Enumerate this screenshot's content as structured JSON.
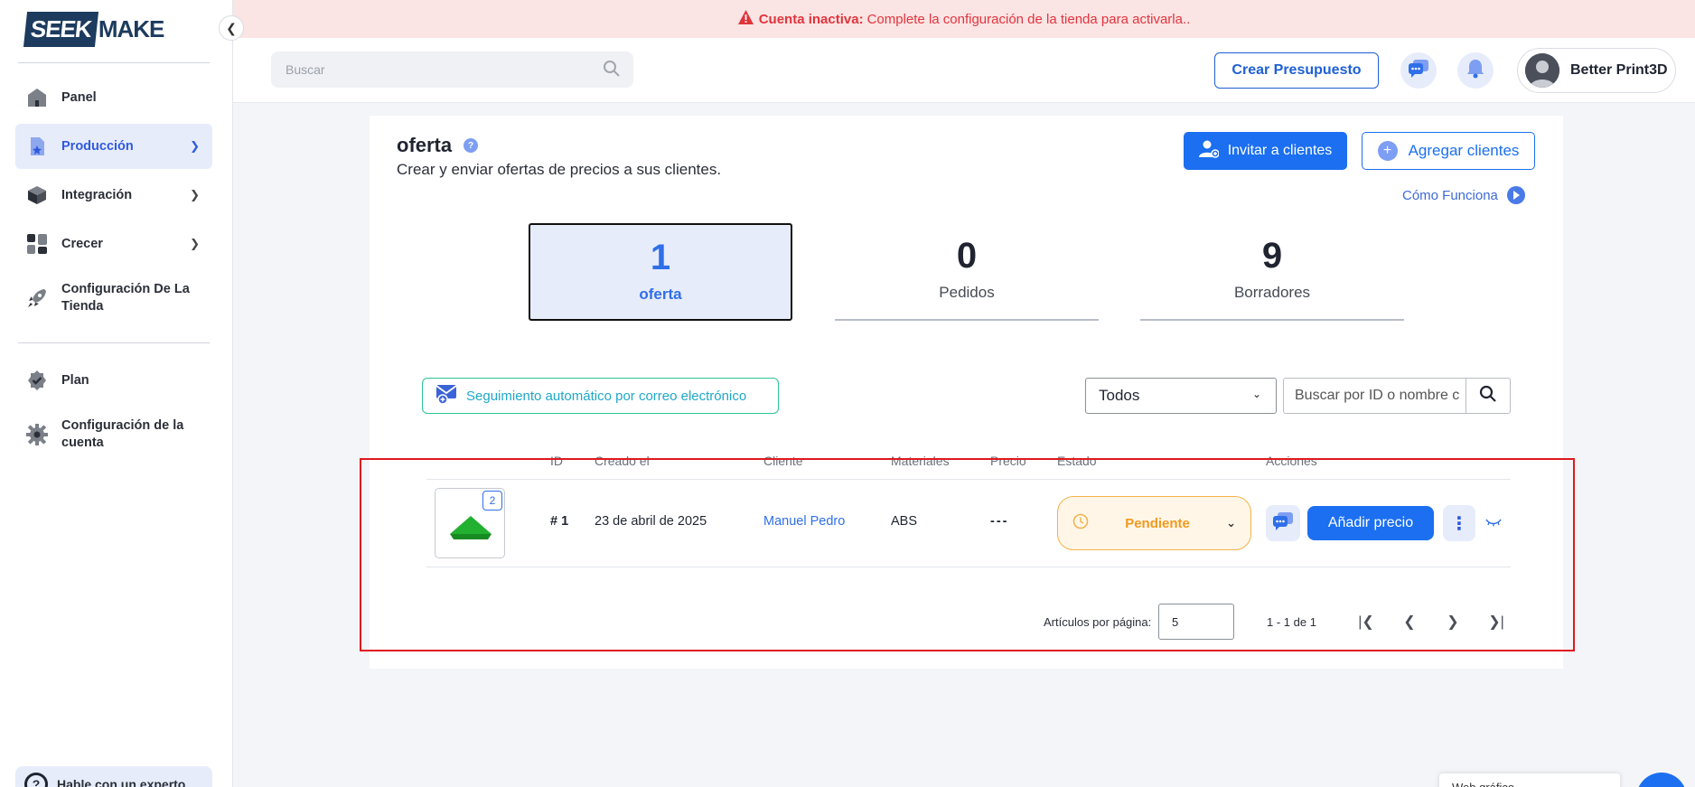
{
  "brand": {
    "logo_left": "SEEK",
    "logo_right": "MAKE"
  },
  "banner": {
    "title": "Cuenta inactiva:",
    "message": "Complete la configuración de la tienda para activarla.."
  },
  "sidebar": {
    "items": [
      {
        "label": "Panel",
        "icon": "home-icon"
      },
      {
        "label": "Producción",
        "icon": "document-star-icon",
        "active": true,
        "expandable": true
      },
      {
        "label": "Integración",
        "icon": "cube-icon",
        "expandable": true
      },
      {
        "label": "Crecer",
        "icon": "grid-icon",
        "expandable": true
      },
      {
        "label": "Configuración De La Tienda",
        "icon": "rocket-icon"
      },
      {
        "label": "Plan",
        "icon": "badge-check-icon"
      },
      {
        "label": "Configuración de la cuenta",
        "icon": "gear-icon"
      }
    ],
    "help": "Hable con un experto"
  },
  "header": {
    "search_placeholder": "Buscar",
    "create_quote": "Crear Presupuesto",
    "user_name": "Better Print3D"
  },
  "page": {
    "title": "oferta",
    "subtitle": "Crear y enviar ofertas de precios a sus clientes.",
    "invite_btn": "Invitar a clientes",
    "add_btn": "Agregar clientes",
    "how_link": "Cómo Funciona"
  },
  "stats": [
    {
      "value": "1",
      "label": "oferta",
      "selected": true
    },
    {
      "value": "0",
      "label": "Pedidos"
    },
    {
      "value": "9",
      "label": "Borradores"
    }
  ],
  "toolbar": {
    "follow_up": "Seguimiento automático por correo electrónico",
    "filter_value": "Todos",
    "search_placeholder": "Buscar por ID o nombre c"
  },
  "table": {
    "columns": [
      "ID",
      "Creado el",
      "Cliente",
      "Materiales",
      "Precio",
      "Estado",
      "Acciones"
    ],
    "rows": [
      {
        "thumb_badge": "2",
        "id": "# 1",
        "created": "23 de abril de 2025",
        "client": "Manuel Pedro",
        "material": "ABS",
        "price": "---",
        "status": "Pendiente",
        "action": "Añadir precio"
      }
    ]
  },
  "pagination": {
    "per_page_label": "Artículos por página:",
    "per_page": "5",
    "range": "1 - 1 de 1"
  },
  "corner_widget": "Web gráfico",
  "colors": {
    "primary": "#1b6ff0",
    "banner_bg": "#fbe4e4",
    "banner_text": "#e0353c",
    "pending": "#ef9a1e",
    "highlight": "#e0181f"
  }
}
